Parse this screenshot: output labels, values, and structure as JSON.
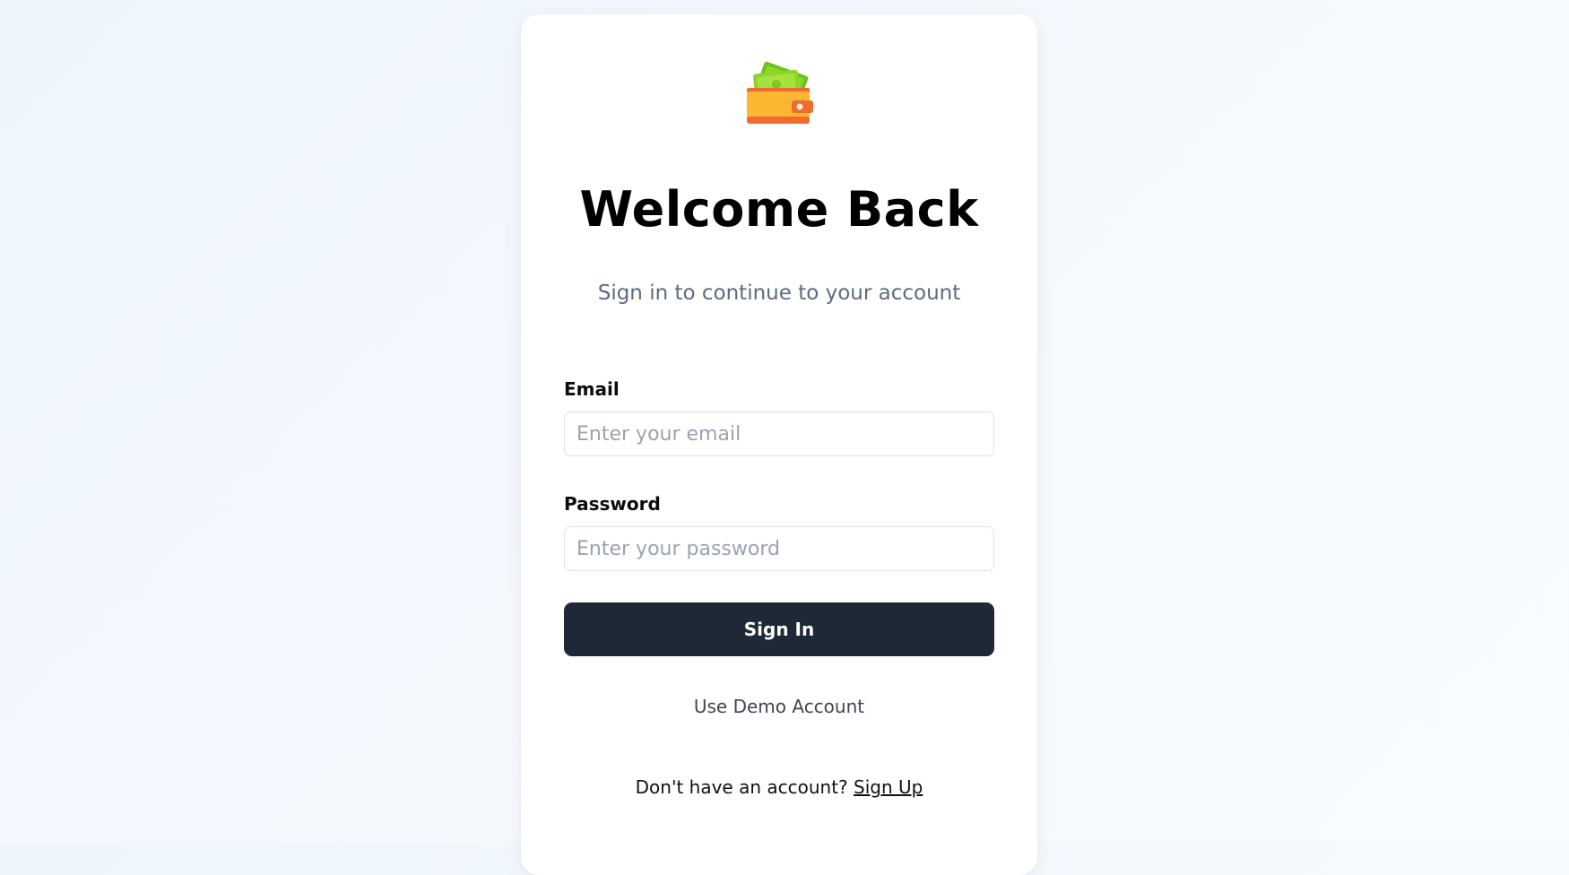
{
  "app": {
    "logo_icon": "wallet-icon"
  },
  "login": {
    "title": "Welcome Back",
    "subtitle": "Sign in to continue to your account",
    "email": {
      "label": "Email",
      "placeholder": "Enter your email",
      "value": ""
    },
    "password": {
      "label": "Password",
      "placeholder": "Enter your password",
      "value": ""
    },
    "sign_in_label": "Sign In",
    "demo_label": "Use Demo Account",
    "signup_prompt": "Don't have an account? ",
    "signup_link": "Sign Up"
  },
  "colors": {
    "primary_button": "#1e2837",
    "subtitle_text": "#5b6b82",
    "wallet_body": "#fbb731",
    "wallet_strap": "#f26a2e",
    "cash": "#8fd42a"
  }
}
